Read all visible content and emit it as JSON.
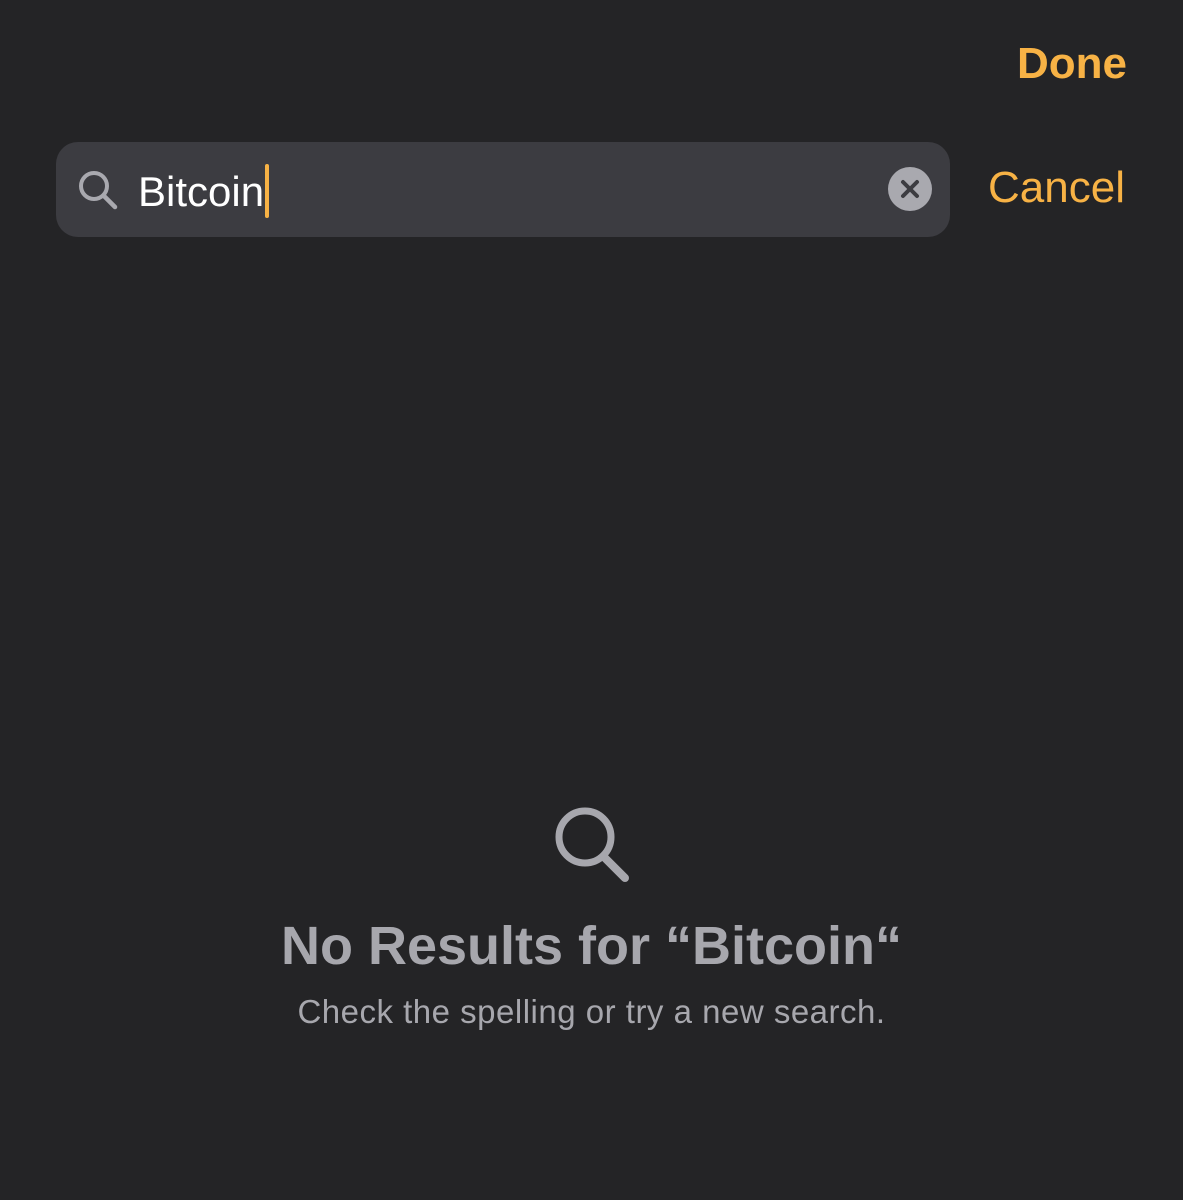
{
  "header": {
    "done_label": "Done"
  },
  "search": {
    "query": "Bitcoin",
    "cancel_label": "Cancel"
  },
  "empty_state": {
    "title": "No Results for “Bitcoin“",
    "subtitle": "Check the spelling or try a new search."
  },
  "colors": {
    "background": "#242426",
    "accent": "#f7b245",
    "search_field": "#3c3c41",
    "muted_text": "#a7a7ad"
  },
  "icons": {
    "search": "magnifying-glass",
    "clear": "x-circle-fill",
    "empty": "magnifying-glass"
  }
}
